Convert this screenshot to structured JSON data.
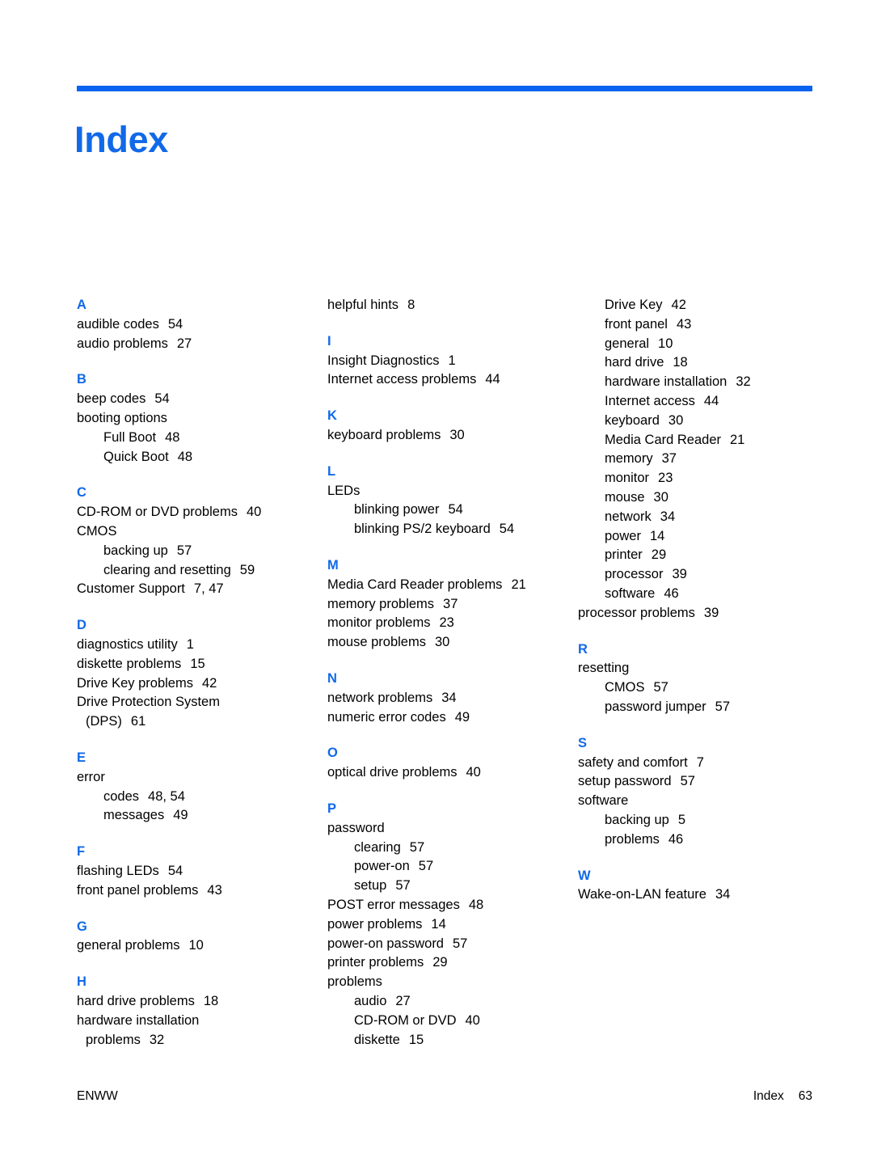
{
  "document": {
    "title": "Index",
    "accent_color": "#1169e8",
    "rule_color": "#0a63f0"
  },
  "footer": {
    "left": "ENWW",
    "label": "Index",
    "page_number": "63"
  },
  "columns": [
    {
      "id": "column-1",
      "blocks": [
        {
          "type": "section",
          "letter": "A",
          "entries": [
            {
              "level": 1,
              "text": "audible codes",
              "pages": "54"
            },
            {
              "level": 1,
              "text": "audio problems",
              "pages": "27"
            }
          ]
        },
        {
          "type": "section",
          "letter": "B",
          "entries": [
            {
              "level": 1,
              "text": "beep codes",
              "pages": "54"
            },
            {
              "level": 1,
              "text": "booting options",
              "pages": ""
            },
            {
              "level": 2,
              "text": "Full Boot",
              "pages": "48"
            },
            {
              "level": 2,
              "text": "Quick Boot",
              "pages": "48"
            }
          ]
        },
        {
          "type": "section",
          "letter": "C",
          "entries": [
            {
              "level": 1,
              "text": "CD-ROM or DVD problems",
              "pages": "40"
            },
            {
              "level": 1,
              "text": "CMOS",
              "pages": ""
            },
            {
              "level": 2,
              "text": "backing up",
              "pages": "57"
            },
            {
              "level": 2,
              "text": "clearing and resetting",
              "pages": "59"
            },
            {
              "level": 1,
              "text": "Customer Support",
              "pages": "7,  47"
            }
          ]
        },
        {
          "type": "section",
          "letter": "D",
          "entries": [
            {
              "level": 1,
              "text": "diagnostics utility",
              "pages": "1"
            },
            {
              "level": 1,
              "text": "diskette problems",
              "pages": "15"
            },
            {
              "level": 1,
              "text": "Drive Key problems",
              "pages": "42"
            },
            {
              "level": 1,
              "text": "Drive Protection System",
              "pages": ""
            },
            {
              "level": 0,
              "text": "(DPS)",
              "pages": "61"
            }
          ]
        },
        {
          "type": "section",
          "letter": "E",
          "entries": [
            {
              "level": 1,
              "text": "error",
              "pages": ""
            },
            {
              "level": 2,
              "text": "codes",
              "pages": "48,  54"
            },
            {
              "level": 2,
              "text": "messages",
              "pages": "49"
            }
          ]
        },
        {
          "type": "section",
          "letter": "F",
          "entries": [
            {
              "level": 1,
              "text": "flashing LEDs",
              "pages": "54"
            },
            {
              "level": 1,
              "text": "front panel problems",
              "pages": "43"
            }
          ]
        },
        {
          "type": "section",
          "letter": "G",
          "entries": [
            {
              "level": 1,
              "text": "general problems",
              "pages": "10"
            }
          ]
        },
        {
          "type": "section",
          "letter": "H",
          "entries": [
            {
              "level": 1,
              "text": "hard drive problems",
              "pages": "18"
            },
            {
              "level": 1,
              "text": "hardware installation",
              "pages": ""
            },
            {
              "level": 0,
              "text": "problems",
              "pages": "32"
            }
          ]
        }
      ]
    },
    {
      "id": "column-2",
      "blocks": [
        {
          "type": "continuation",
          "letter": "",
          "entries": [
            {
              "level": 1,
              "text": "helpful hints",
              "pages": "8"
            }
          ]
        },
        {
          "type": "section",
          "letter": "I",
          "entries": [
            {
              "level": 1,
              "text": "Insight Diagnostics",
              "pages": "1"
            },
            {
              "level": 1,
              "text": "Internet access problems",
              "pages": "44"
            }
          ]
        },
        {
          "type": "section",
          "letter": "K",
          "entries": [
            {
              "level": 1,
              "text": "keyboard problems",
              "pages": "30"
            }
          ]
        },
        {
          "type": "section",
          "letter": "L",
          "entries": [
            {
              "level": 1,
              "text": "LEDs",
              "pages": ""
            },
            {
              "level": 2,
              "text": "blinking power",
              "pages": "54"
            },
            {
              "level": 2,
              "text": "blinking PS/2 keyboard",
              "pages": "54"
            }
          ]
        },
        {
          "type": "section",
          "letter": "M",
          "entries": [
            {
              "level": 1,
              "text": "Media Card Reader problems",
              "pages": "21"
            },
            {
              "level": 1,
              "text": "memory problems",
              "pages": "37"
            },
            {
              "level": 1,
              "text": "monitor problems",
              "pages": "23"
            },
            {
              "level": 1,
              "text": "mouse problems",
              "pages": "30"
            }
          ]
        },
        {
          "type": "section",
          "letter": "N",
          "entries": [
            {
              "level": 1,
              "text": "network problems",
              "pages": "34"
            },
            {
              "level": 1,
              "text": "numeric error codes",
              "pages": "49"
            }
          ]
        },
        {
          "type": "section",
          "letter": "O",
          "entries": [
            {
              "level": 1,
              "text": "optical drive problems",
              "pages": "40"
            }
          ]
        },
        {
          "type": "section",
          "letter": "P",
          "entries": [
            {
              "level": 1,
              "text": "password",
              "pages": ""
            },
            {
              "level": 2,
              "text": "clearing",
              "pages": "57"
            },
            {
              "level": 2,
              "text": "power-on",
              "pages": "57"
            },
            {
              "level": 2,
              "text": "setup",
              "pages": "57"
            },
            {
              "level": 1,
              "text": "POST error messages",
              "pages": "48"
            },
            {
              "level": 1,
              "text": "power problems",
              "pages": "14"
            },
            {
              "level": 1,
              "text": "power-on password",
              "pages": "57"
            },
            {
              "level": 1,
              "text": "printer problems",
              "pages": "29"
            },
            {
              "level": 1,
              "text": "problems",
              "pages": ""
            },
            {
              "level": 2,
              "text": "audio",
              "pages": "27"
            },
            {
              "level": 2,
              "text": "CD-ROM or DVD",
              "pages": "40"
            },
            {
              "level": 2,
              "text": "diskette",
              "pages": "15"
            }
          ]
        }
      ]
    },
    {
      "id": "column-3",
      "blocks": [
        {
          "type": "continuation",
          "letter": "",
          "entries": [
            {
              "level": 2,
              "text": "Drive Key",
              "pages": "42"
            },
            {
              "level": 2,
              "text": "front panel",
              "pages": "43"
            },
            {
              "level": 2,
              "text": "general",
              "pages": "10"
            },
            {
              "level": 2,
              "text": "hard drive",
              "pages": "18"
            },
            {
              "level": 2,
              "text": "hardware installation",
              "pages": "32"
            },
            {
              "level": 2,
              "text": "Internet access",
              "pages": "44"
            },
            {
              "level": 2,
              "text": "keyboard",
              "pages": "30"
            },
            {
              "level": 2,
              "text": "Media Card Reader",
              "pages": "21"
            },
            {
              "level": 2,
              "text": "memory",
              "pages": "37"
            },
            {
              "level": 2,
              "text": "monitor",
              "pages": "23"
            },
            {
              "level": 2,
              "text": "mouse",
              "pages": "30"
            },
            {
              "level": 2,
              "text": "network",
              "pages": "34"
            },
            {
              "level": 2,
              "text": "power",
              "pages": "14"
            },
            {
              "level": 2,
              "text": "printer",
              "pages": "29"
            },
            {
              "level": 2,
              "text": "processor",
              "pages": "39"
            },
            {
              "level": 2,
              "text": "software",
              "pages": "46"
            },
            {
              "level": 1,
              "text": "processor problems",
              "pages": "39"
            }
          ]
        },
        {
          "type": "section",
          "letter": "R",
          "entries": [
            {
              "level": 1,
              "text": "resetting",
              "pages": ""
            },
            {
              "level": 2,
              "text": "CMOS",
              "pages": "57"
            },
            {
              "level": 2,
              "text": "password jumper",
              "pages": "57"
            }
          ]
        },
        {
          "type": "section",
          "letter": "S",
          "entries": [
            {
              "level": 1,
              "text": "safety and comfort",
              "pages": "7"
            },
            {
              "level": 1,
              "text": "setup password",
              "pages": "57"
            },
            {
              "level": 1,
              "text": "software",
              "pages": ""
            },
            {
              "level": 2,
              "text": "backing up",
              "pages": "5"
            },
            {
              "level": 2,
              "text": "problems",
              "pages": "46"
            }
          ]
        },
        {
          "type": "section",
          "letter": "W",
          "entries": [
            {
              "level": 1,
              "text": "Wake-on-LAN feature",
              "pages": "34"
            }
          ]
        }
      ]
    }
  ]
}
